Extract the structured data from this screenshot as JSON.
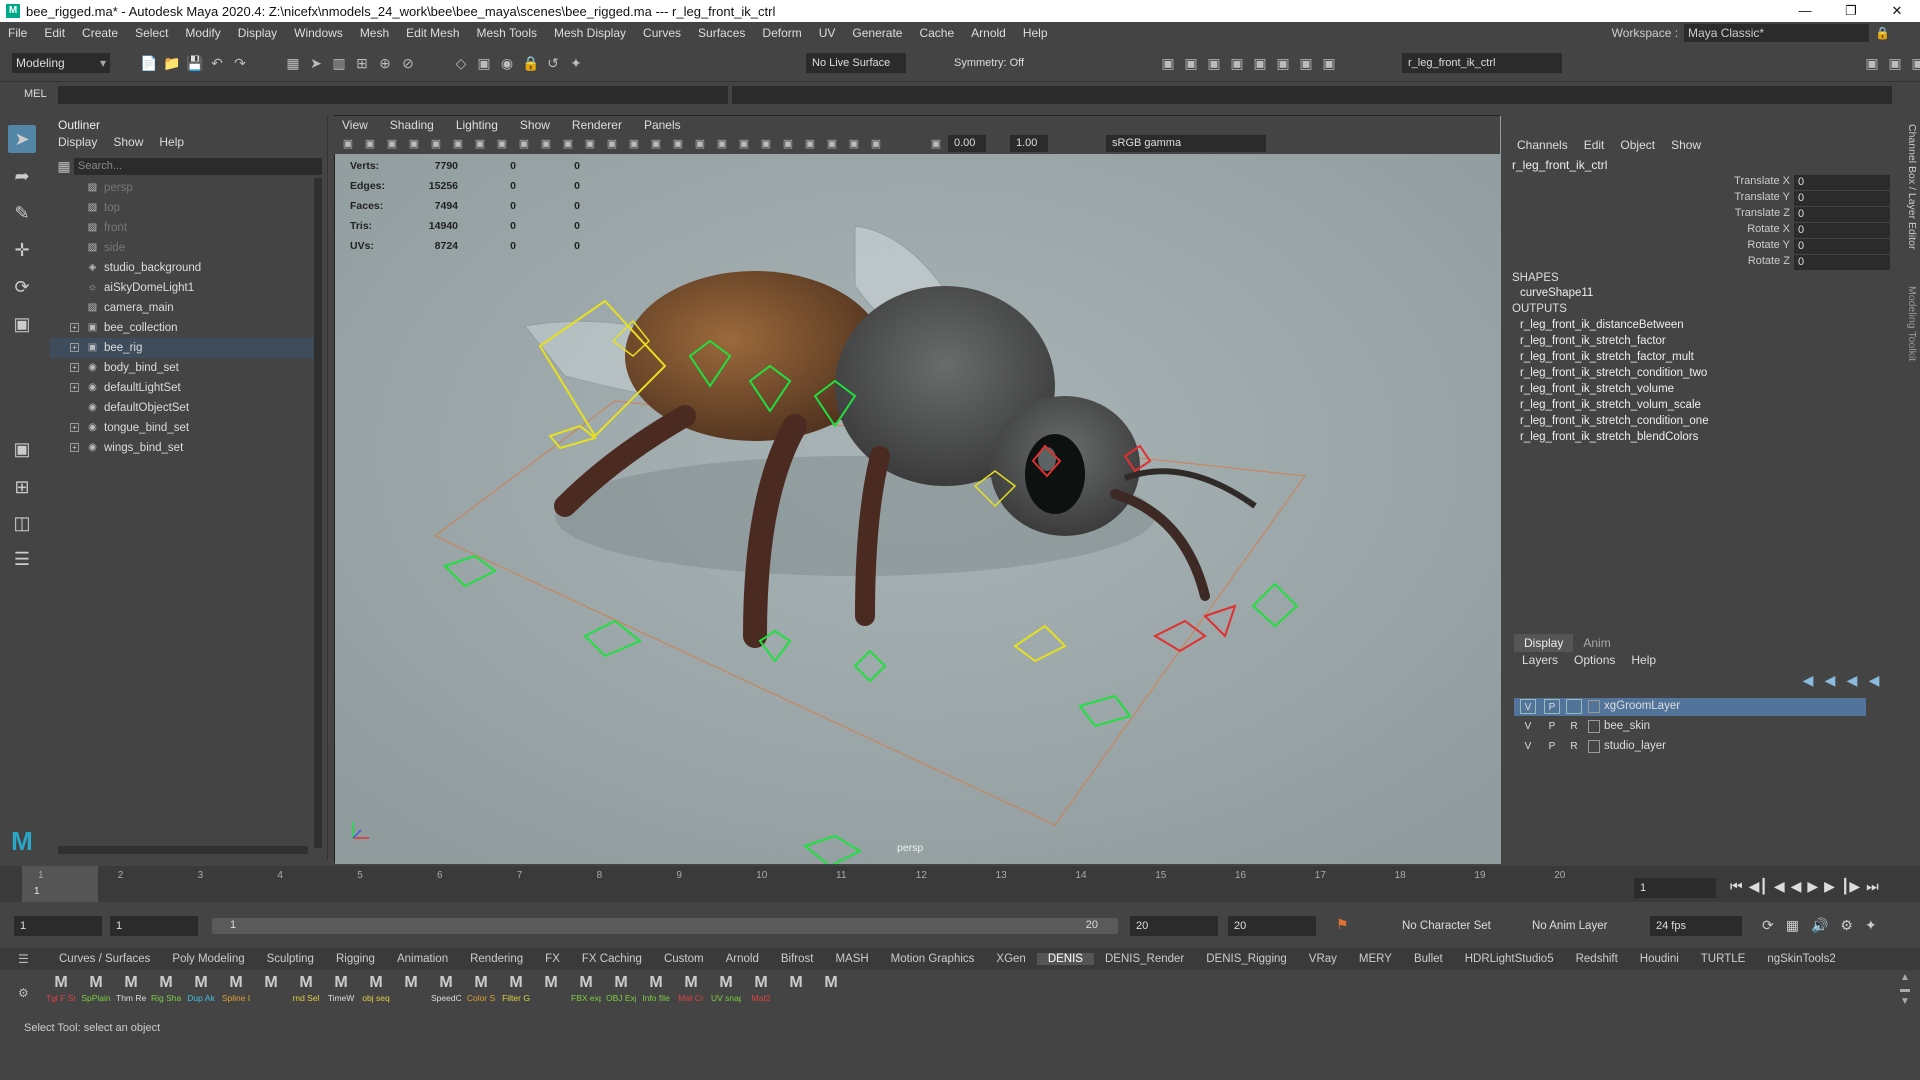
{
  "window": {
    "title": "bee_rigged.ma* - Autodesk Maya 2020.4: Z:\\nicefx\\nmodels_24_work\\bee\\bee_maya\\scenes\\bee_rigged.ma  ---  r_leg_front_ik_ctrl"
  },
  "menu": [
    "File",
    "Edit",
    "Create",
    "Select",
    "Modify",
    "Display",
    "Windows",
    "Mesh",
    "Edit Mesh",
    "Mesh Tools",
    "Mesh Display",
    "Curves",
    "Surfaces",
    "Deform",
    "UV",
    "Generate",
    "Cache",
    "Arnold",
    "Help"
  ],
  "workspace": {
    "label": "Workspace :",
    "value": "Maya Classic*"
  },
  "status_line": {
    "mode": "Modeling",
    "live_surface": "No Live Surface",
    "symmetry": "Symmetry: Off",
    "object_name": "r_leg_front_ik_ctrl"
  },
  "command_line": {
    "label": "MEL"
  },
  "outliner": {
    "title": "Outliner",
    "menu": [
      "Display",
      "Show",
      "Help"
    ],
    "search_placeholder": "Search...",
    "items": [
      {
        "label": "persp",
        "icon": "camera-icon",
        "dim": true,
        "expandable": false
      },
      {
        "label": "top",
        "icon": "camera-icon",
        "dim": true,
        "expandable": false
      },
      {
        "label": "front",
        "icon": "camera-icon",
        "dim": true,
        "expandable": false
      },
      {
        "label": "side",
        "icon": "camera-icon",
        "dim": true,
        "expandable": false
      },
      {
        "label": "studio_background",
        "icon": "mesh-icon",
        "dim": false,
        "expandable": false
      },
      {
        "label": "aiSkyDomeLight1",
        "icon": "light-icon",
        "dim": false,
        "expandable": false
      },
      {
        "label": "camera_main",
        "icon": "camera-icon",
        "dim": false,
        "expandable": false
      },
      {
        "label": "bee_collection",
        "icon": "group-icon",
        "dim": false,
        "expandable": true
      },
      {
        "label": "bee_rig",
        "icon": "group-icon",
        "dim": false,
        "expandable": true,
        "selected": true
      },
      {
        "label": "body_bind_set",
        "icon": "set-icon",
        "dim": false,
        "expandable": true
      },
      {
        "label": "defaultLightSet",
        "icon": "set-icon",
        "dim": false,
        "expandable": true
      },
      {
        "label": "defaultObjectSet",
        "icon": "set-icon",
        "dim": false,
        "expandable": false
      },
      {
        "label": "tongue_bind_set",
        "icon": "set-icon",
        "dim": false,
        "expandable": true
      },
      {
        "label": "wings_bind_set",
        "icon": "set-icon",
        "dim": false,
        "expandable": true
      }
    ]
  },
  "viewport": {
    "menu": [
      "View",
      "Shading",
      "Lighting",
      "Show",
      "Renderer",
      "Panels"
    ],
    "exposure": "0.00",
    "gamma": "1.00",
    "color_space": "sRGB gamma",
    "camera_label": "persp",
    "hud": [
      {
        "label": "Verts:",
        "v1": "7790",
        "v2": "0",
        "v3": "0"
      },
      {
        "label": "Edges:",
        "v1": "15256",
        "v2": "0",
        "v3": "0"
      },
      {
        "label": "Faces:",
        "v1": "7494",
        "v2": "0",
        "v3": "0"
      },
      {
        "label": "Tris:",
        "v1": "14940",
        "v2": "0",
        "v3": "0"
      },
      {
        "label": "UVs:",
        "v1": "8724",
        "v2": "0",
        "v3": "0"
      }
    ]
  },
  "channel_box": {
    "menu": [
      "Channels",
      "Edit",
      "Object",
      "Show"
    ],
    "node": "r_leg_front_ik_ctrl",
    "attributes": [
      {
        "label": "Translate X",
        "value": "0"
      },
      {
        "label": "Translate Y",
        "value": "0"
      },
      {
        "label": "Translate Z",
        "value": "0"
      },
      {
        "label": "Rotate X",
        "value": "0"
      },
      {
        "label": "Rotate Y",
        "value": "0"
      },
      {
        "label": "Rotate Z",
        "value": "0"
      }
    ],
    "shapes_header": "SHAPES",
    "shape": "curveShape11",
    "outputs_header": "OUTPUTS",
    "outputs": [
      "r_leg_front_ik_distanceBetween",
      "r_leg_front_ik_stretch_factor",
      "r_leg_front_ik_stretch_factor_mult",
      "r_leg_front_ik_stretch_condition_two",
      "r_leg_front_ik_stretch_volume",
      "r_leg_front_ik_stretch_volum_scale",
      "r_leg_front_ik_stretch_condition_one",
      "r_leg_front_ik_stretch_blendColors"
    ],
    "side_tabs": [
      "Channel Box / Layer Editor",
      "Modeling Toolkit"
    ]
  },
  "layer_editor": {
    "tabs": [
      "Display",
      "Anim"
    ],
    "menu": [
      "Layers",
      "Options",
      "Help"
    ],
    "layers": [
      {
        "v": "V",
        "p": "P",
        "r": "",
        "name": "xgGroomLayer",
        "selected": true
      },
      {
        "v": "V",
        "p": "P",
        "r": "R",
        "name": "bee_skin",
        "selected": false
      },
      {
        "v": "V",
        "p": "P",
        "r": "R",
        "name": "studio_layer",
        "selected": false
      }
    ]
  },
  "timeline": {
    "ticks": [
      "1",
      "2",
      "3",
      "4",
      "5",
      "6",
      "7",
      "8",
      "9",
      "10",
      "11",
      "12",
      "13",
      "14",
      "15",
      "16",
      "17",
      "18",
      "19",
      "20"
    ],
    "current_frame": "1"
  },
  "range": {
    "start": "1",
    "playback_start": "1",
    "slider_start": "1",
    "slider_end": "20",
    "playback_end": "20",
    "end": "20",
    "character_set": "No Character Set",
    "anim_layer": "No Anim Layer",
    "fps": "24 fps"
  },
  "shelf_tabs": [
    "Curves / Surfaces",
    "Poly Modeling",
    "Sculpting",
    "Rigging",
    "Animation",
    "Rendering",
    "FX",
    "FX Caching",
    "Custom",
    "Arnold",
    "Bifrost",
    "MASH",
    "Motion Graphics",
    "XGen",
    "DENIS",
    "DENIS_Render",
    "DENIS_Rigging",
    "VRay",
    "MERY",
    "Bullet",
    "HDRLightStudio5",
    "Redshift",
    "Houdini",
    "TURTLE",
    "ngSkinTools2"
  ],
  "active_shelf": "DENIS",
  "shelf_icons": [
    {
      "label": "Tgl F Sm",
      "color": "#e04040"
    },
    {
      "label": "SpPlain",
      "color": "#7ad040"
    },
    {
      "label": "Thm Re",
      "color": "#dddddd"
    },
    {
      "label": "Rig Sha",
      "color": "#7ad040"
    },
    {
      "label": "Dup Ak",
      "color": "#40c0e0"
    },
    {
      "label": "Spline I",
      "color": "#e0a030"
    },
    {
      "label": "",
      "color": "#dddddd"
    },
    {
      "label": "rnd Sel",
      "color": "#e0d040"
    },
    {
      "label": "TimeW",
      "color": "#dddddd"
    },
    {
      "label": "obj seq",
      "color": "#e0d040"
    },
    {
      "label": "",
      "color": "#dddddd"
    },
    {
      "label": "SpeedC",
      "color": "#dddddd"
    },
    {
      "label": "Color S",
      "color": "#e0a030"
    },
    {
      "label": "Filter G",
      "color": "#e0d040"
    },
    {
      "label": "",
      "color": "#dddddd"
    },
    {
      "label": "FBX exp",
      "color": "#7ad040"
    },
    {
      "label": "OBJ Exp",
      "color": "#7ad040"
    },
    {
      "label": "Info file",
      "color": "#7ad040"
    },
    {
      "label": "Mat Cr",
      "color": "#e04040"
    },
    {
      "label": "UV snap",
      "color": "#7ad040"
    },
    {
      "label": "Mat2",
      "color": "#e04040"
    },
    {
      "label": "",
      "color": "#e04040"
    },
    {
      "label": "",
      "color": "#dddddd"
    }
  ],
  "help_line": "Select Tool: select an object"
}
